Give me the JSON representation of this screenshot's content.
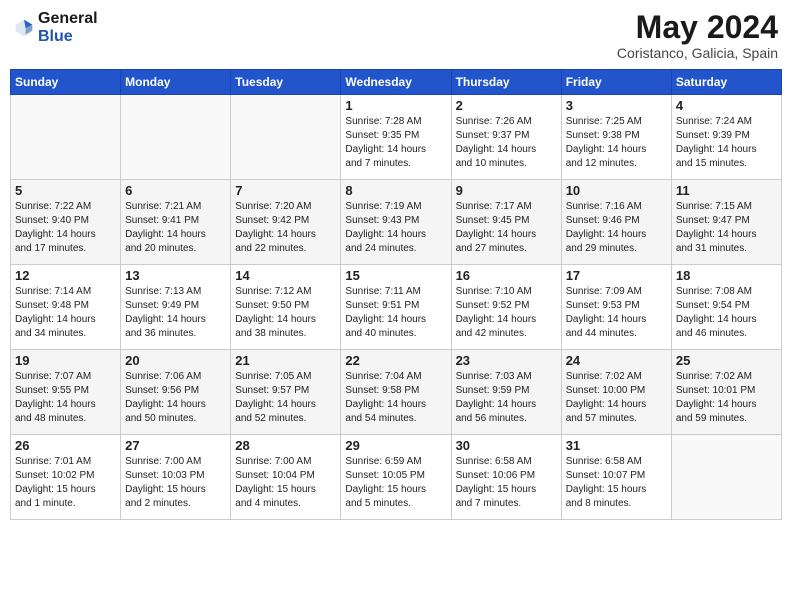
{
  "header": {
    "logo_general": "General",
    "logo_blue": "Blue",
    "month_year": "May 2024",
    "location": "Coristanco, Galicia, Spain"
  },
  "days_of_week": [
    "Sunday",
    "Monday",
    "Tuesday",
    "Wednesday",
    "Thursday",
    "Friday",
    "Saturday"
  ],
  "weeks": [
    [
      {
        "day": "",
        "content": ""
      },
      {
        "day": "",
        "content": ""
      },
      {
        "day": "",
        "content": ""
      },
      {
        "day": "1",
        "content": "Sunrise: 7:28 AM\nSunset: 9:35 PM\nDaylight: 14 hours\nand 7 minutes."
      },
      {
        "day": "2",
        "content": "Sunrise: 7:26 AM\nSunset: 9:37 PM\nDaylight: 14 hours\nand 10 minutes."
      },
      {
        "day": "3",
        "content": "Sunrise: 7:25 AM\nSunset: 9:38 PM\nDaylight: 14 hours\nand 12 minutes."
      },
      {
        "day": "4",
        "content": "Sunrise: 7:24 AM\nSunset: 9:39 PM\nDaylight: 14 hours\nand 15 minutes."
      }
    ],
    [
      {
        "day": "5",
        "content": "Sunrise: 7:22 AM\nSunset: 9:40 PM\nDaylight: 14 hours\nand 17 minutes."
      },
      {
        "day": "6",
        "content": "Sunrise: 7:21 AM\nSunset: 9:41 PM\nDaylight: 14 hours\nand 20 minutes."
      },
      {
        "day": "7",
        "content": "Sunrise: 7:20 AM\nSunset: 9:42 PM\nDaylight: 14 hours\nand 22 minutes."
      },
      {
        "day": "8",
        "content": "Sunrise: 7:19 AM\nSunset: 9:43 PM\nDaylight: 14 hours\nand 24 minutes."
      },
      {
        "day": "9",
        "content": "Sunrise: 7:17 AM\nSunset: 9:45 PM\nDaylight: 14 hours\nand 27 minutes."
      },
      {
        "day": "10",
        "content": "Sunrise: 7:16 AM\nSunset: 9:46 PM\nDaylight: 14 hours\nand 29 minutes."
      },
      {
        "day": "11",
        "content": "Sunrise: 7:15 AM\nSunset: 9:47 PM\nDaylight: 14 hours\nand 31 minutes."
      }
    ],
    [
      {
        "day": "12",
        "content": "Sunrise: 7:14 AM\nSunset: 9:48 PM\nDaylight: 14 hours\nand 34 minutes."
      },
      {
        "day": "13",
        "content": "Sunrise: 7:13 AM\nSunset: 9:49 PM\nDaylight: 14 hours\nand 36 minutes."
      },
      {
        "day": "14",
        "content": "Sunrise: 7:12 AM\nSunset: 9:50 PM\nDaylight: 14 hours\nand 38 minutes."
      },
      {
        "day": "15",
        "content": "Sunrise: 7:11 AM\nSunset: 9:51 PM\nDaylight: 14 hours\nand 40 minutes."
      },
      {
        "day": "16",
        "content": "Sunrise: 7:10 AM\nSunset: 9:52 PM\nDaylight: 14 hours\nand 42 minutes."
      },
      {
        "day": "17",
        "content": "Sunrise: 7:09 AM\nSunset: 9:53 PM\nDaylight: 14 hours\nand 44 minutes."
      },
      {
        "day": "18",
        "content": "Sunrise: 7:08 AM\nSunset: 9:54 PM\nDaylight: 14 hours\nand 46 minutes."
      }
    ],
    [
      {
        "day": "19",
        "content": "Sunrise: 7:07 AM\nSunset: 9:55 PM\nDaylight: 14 hours\nand 48 minutes."
      },
      {
        "day": "20",
        "content": "Sunrise: 7:06 AM\nSunset: 9:56 PM\nDaylight: 14 hours\nand 50 minutes."
      },
      {
        "day": "21",
        "content": "Sunrise: 7:05 AM\nSunset: 9:57 PM\nDaylight: 14 hours\nand 52 minutes."
      },
      {
        "day": "22",
        "content": "Sunrise: 7:04 AM\nSunset: 9:58 PM\nDaylight: 14 hours\nand 54 minutes."
      },
      {
        "day": "23",
        "content": "Sunrise: 7:03 AM\nSunset: 9:59 PM\nDaylight: 14 hours\nand 56 minutes."
      },
      {
        "day": "24",
        "content": "Sunrise: 7:02 AM\nSunset: 10:00 PM\nDaylight: 14 hours\nand 57 minutes."
      },
      {
        "day": "25",
        "content": "Sunrise: 7:02 AM\nSunset: 10:01 PM\nDaylight: 14 hours\nand 59 minutes."
      }
    ],
    [
      {
        "day": "26",
        "content": "Sunrise: 7:01 AM\nSunset: 10:02 PM\nDaylight: 15 hours\nand 1 minute."
      },
      {
        "day": "27",
        "content": "Sunrise: 7:00 AM\nSunset: 10:03 PM\nDaylight: 15 hours\nand 2 minutes."
      },
      {
        "day": "28",
        "content": "Sunrise: 7:00 AM\nSunset: 10:04 PM\nDaylight: 15 hours\nand 4 minutes."
      },
      {
        "day": "29",
        "content": "Sunrise: 6:59 AM\nSunset: 10:05 PM\nDaylight: 15 hours\nand 5 minutes."
      },
      {
        "day": "30",
        "content": "Sunrise: 6:58 AM\nSunset: 10:06 PM\nDaylight: 15 hours\nand 7 minutes."
      },
      {
        "day": "31",
        "content": "Sunrise: 6:58 AM\nSunset: 10:07 PM\nDaylight: 15 hours\nand 8 minutes."
      },
      {
        "day": "",
        "content": ""
      }
    ]
  ]
}
